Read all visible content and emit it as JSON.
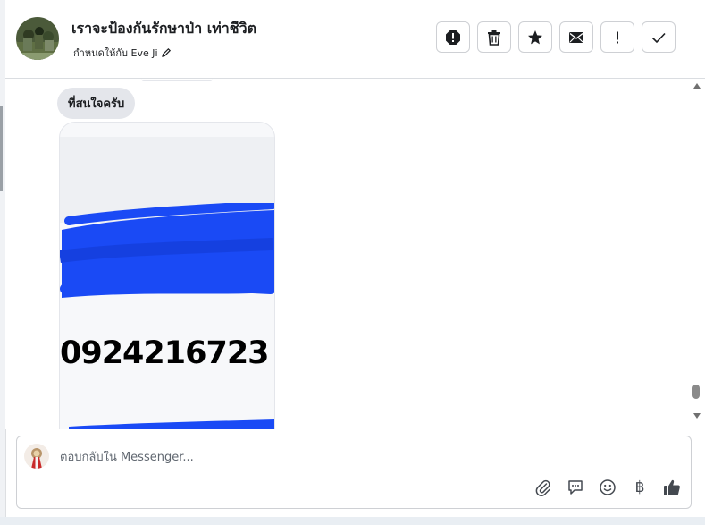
{
  "header": {
    "title": "เราจะป้องกันรักษาป่า เท่าชีวิต",
    "assigned_to": "กำหนดให้กับ Eve Ji",
    "actions": [
      {
        "name": "report-icon"
      },
      {
        "name": "trash-icon"
      },
      {
        "name": "star-icon"
      },
      {
        "name": "envelope-icon"
      },
      {
        "name": "exclamation-icon"
      },
      {
        "name": "check-icon"
      }
    ]
  },
  "messages": {
    "bubble_text": "ที่สนใจครับ",
    "image_card": {
      "phone_number": "0924216723",
      "redaction_color": "#1a4af5"
    }
  },
  "composer": {
    "placeholder": "ตอบกลับใน Messenger...",
    "tools": [
      "paperclip-icon",
      "saved-reply-icon",
      "emoji-icon",
      "baht-icon",
      "thumbs-up-icon"
    ],
    "baht_symbol": "฿"
  },
  "colors": {
    "border": "#ced0d4",
    "bubble_bg": "#e4e6eb",
    "thumbs_up": "#444950"
  }
}
